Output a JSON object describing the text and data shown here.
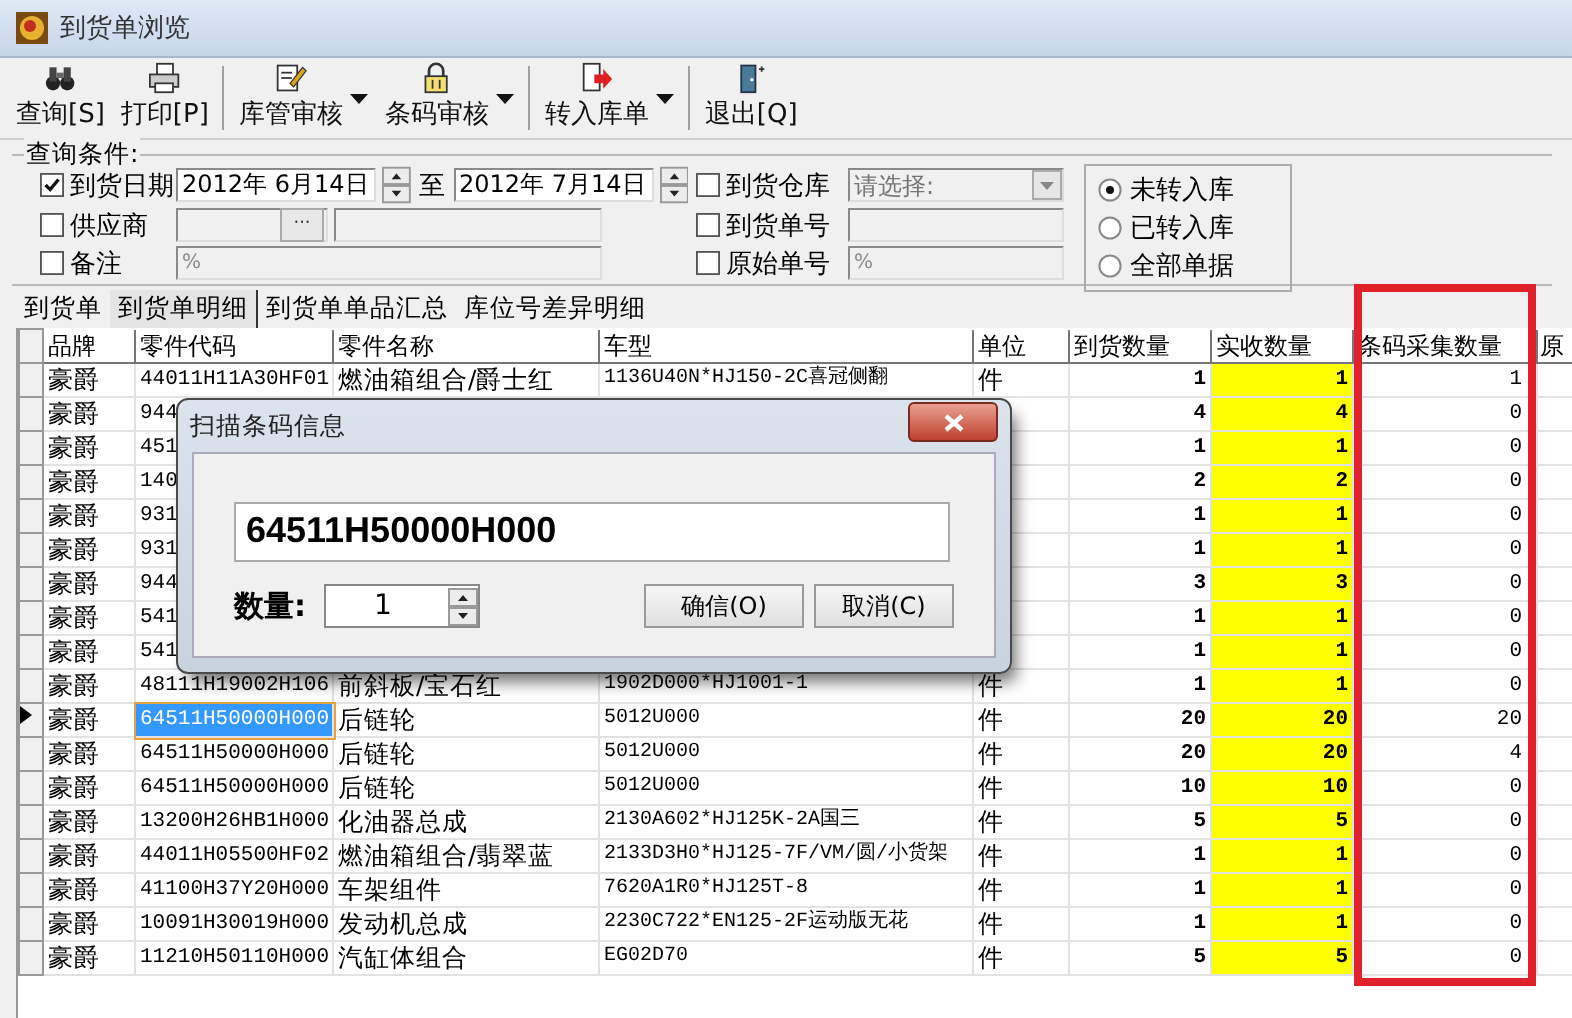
{
  "window": {
    "title": "到货单浏览"
  },
  "toolbar": [
    {
      "label": "查询[S]",
      "kind": "button",
      "separator_after": false
    },
    {
      "label": "打印[P]",
      "kind": "button",
      "separator_after": true
    },
    {
      "label": "库管审核",
      "kind": "split",
      "separator_after": false
    },
    {
      "label": "条码审核",
      "kind": "split",
      "separator_after": true
    },
    {
      "label": "转入库单",
      "kind": "split",
      "separator_after": true
    },
    {
      "label": "退出[Q]",
      "kind": "button",
      "separator_after": false
    }
  ],
  "query": {
    "legend": "查询条件:",
    "arrival_date": {
      "label": "到货日期",
      "checked": true,
      "from": "2012年 6月14日",
      "to_label": "至",
      "to": "2012年 7月14日"
    },
    "warehouse": {
      "label": "到货仓库",
      "checked": false,
      "placeholder": "请选择:"
    },
    "supplier": {
      "label": "供应商",
      "checked": false,
      "browse_button": "···"
    },
    "arrival_no": {
      "label": "到货单号",
      "checked": false
    },
    "remark": {
      "label": "备注",
      "checked": false,
      "value": "%"
    },
    "original_no": {
      "label": "原始单号",
      "checked": false,
      "value": "%"
    },
    "status_options": [
      {
        "label": "未转入库",
        "selected": true
      },
      {
        "label": "已转入库",
        "selected": false
      },
      {
        "label": "全部单据",
        "selected": false
      }
    ]
  },
  "tabs": [
    {
      "label": "到货单",
      "selected": false
    },
    {
      "label": "到货单明细",
      "selected": true
    },
    {
      "label": "到货单单品汇总",
      "selected": false
    },
    {
      "label": "库位号差异明细",
      "selected": false
    }
  ],
  "table": {
    "columns": [
      "品牌",
      "零件代码",
      "零件名称",
      "车型",
      "单位",
      "到货数量",
      "实收数量",
      "条码采集数量",
      "原"
    ],
    "rows": [
      {
        "brand": "豪爵",
        "code": "44011H11A30HF01",
        "name": "燃油箱组合/爵士红",
        "model": "1136U40N*HJ150-2C喜冠侧翻",
        "unit": "件",
        "arrived": "1",
        "received": "1",
        "scanned": "1",
        "selected": false
      },
      {
        "brand": "豪爵",
        "code": "944",
        "arrived": "4",
        "received": "4",
        "scanned": "0",
        "selected": false
      },
      {
        "brand": "豪爵",
        "code": "451",
        "arrived": "1",
        "received": "1",
        "scanned": "0",
        "selected": false
      },
      {
        "brand": "豪爵",
        "code": "140",
        "arrived": "2",
        "received": "2",
        "scanned": "0",
        "selected": false
      },
      {
        "brand": "豪爵",
        "code": "931",
        "arrived": "1",
        "received": "1",
        "scanned": "0",
        "selected": false
      },
      {
        "brand": "豪爵",
        "code": "931",
        "arrived": "1",
        "received": "1",
        "scanned": "0",
        "selected": false
      },
      {
        "brand": "豪爵",
        "code": "944",
        "arrived": "3",
        "received": "3",
        "scanned": "0",
        "selected": false
      },
      {
        "brand": "豪爵",
        "code": "541",
        "arrived": "1",
        "received": "1",
        "scanned": "0",
        "selected": false
      },
      {
        "brand": "豪爵",
        "code": "541",
        "arrived": "1",
        "received": "1",
        "scanned": "0",
        "selected": false
      },
      {
        "brand": "豪爵",
        "code": "48111H19002H106",
        "name": "前斜板/宝石红",
        "model": "1902D000*HJ1001-1",
        "unit": "件",
        "arrived": "1",
        "received": "1",
        "scanned": "0",
        "selected": false
      },
      {
        "brand": "豪爵",
        "code": "64511H50000H000",
        "name": "后链轮",
        "model": "5012U000",
        "unit": "件",
        "arrived": "20",
        "received": "20",
        "scanned": "20",
        "selected": true
      },
      {
        "brand": "豪爵",
        "code": "64511H50000H000",
        "name": "后链轮",
        "model": "5012U000",
        "unit": "件",
        "arrived": "20",
        "received": "20",
        "scanned": "4",
        "selected": false
      },
      {
        "brand": "豪爵",
        "code": "64511H50000H000",
        "name": "后链轮",
        "model": "5012U000",
        "unit": "件",
        "arrived": "10",
        "received": "10",
        "scanned": "0",
        "selected": false
      },
      {
        "brand": "豪爵",
        "code": "13200H26HB1H000",
        "name": "化油器总成",
        "model": "2130A602*HJ125K-2A国三",
        "unit": "件",
        "arrived": "5",
        "received": "5",
        "scanned": "0",
        "selected": false
      },
      {
        "brand": "豪爵",
        "code": "44011H05500HF02",
        "name": "燃油箱组合/翡翠蓝",
        "model": "2133D3H0*HJ125-7F/VM/圆/小货架",
        "unit": "件",
        "arrived": "1",
        "received": "1",
        "scanned": "0",
        "selected": false
      },
      {
        "brand": "豪爵",
        "code": "41100H37Y20H000",
        "name": "车架组件",
        "model": "7620A1R0*HJ125T-8",
        "unit": "件",
        "arrived": "1",
        "received": "1",
        "scanned": "0",
        "selected": false
      },
      {
        "brand": "豪爵",
        "code": "10091H30019H000",
        "name": "发动机总成",
        "model": "2230C722*EN125-2F运动版无花",
        "unit": "件",
        "arrived": "1",
        "received": "1",
        "scanned": "0",
        "selected": false
      },
      {
        "brand": "豪爵",
        "code": "11210H50110H000",
        "name": "汽缸体组合",
        "model": "EG02D70",
        "unit": "件",
        "arrived": "5",
        "received": "5",
        "scanned": "0",
        "selected": false
      }
    ]
  },
  "dialog": {
    "title": "扫描条码信息",
    "barcode": "64511H50000H000",
    "qty_label": "数量:",
    "qty": "1",
    "buttons": [
      "确信(O)",
      "取消(C)"
    ]
  }
}
